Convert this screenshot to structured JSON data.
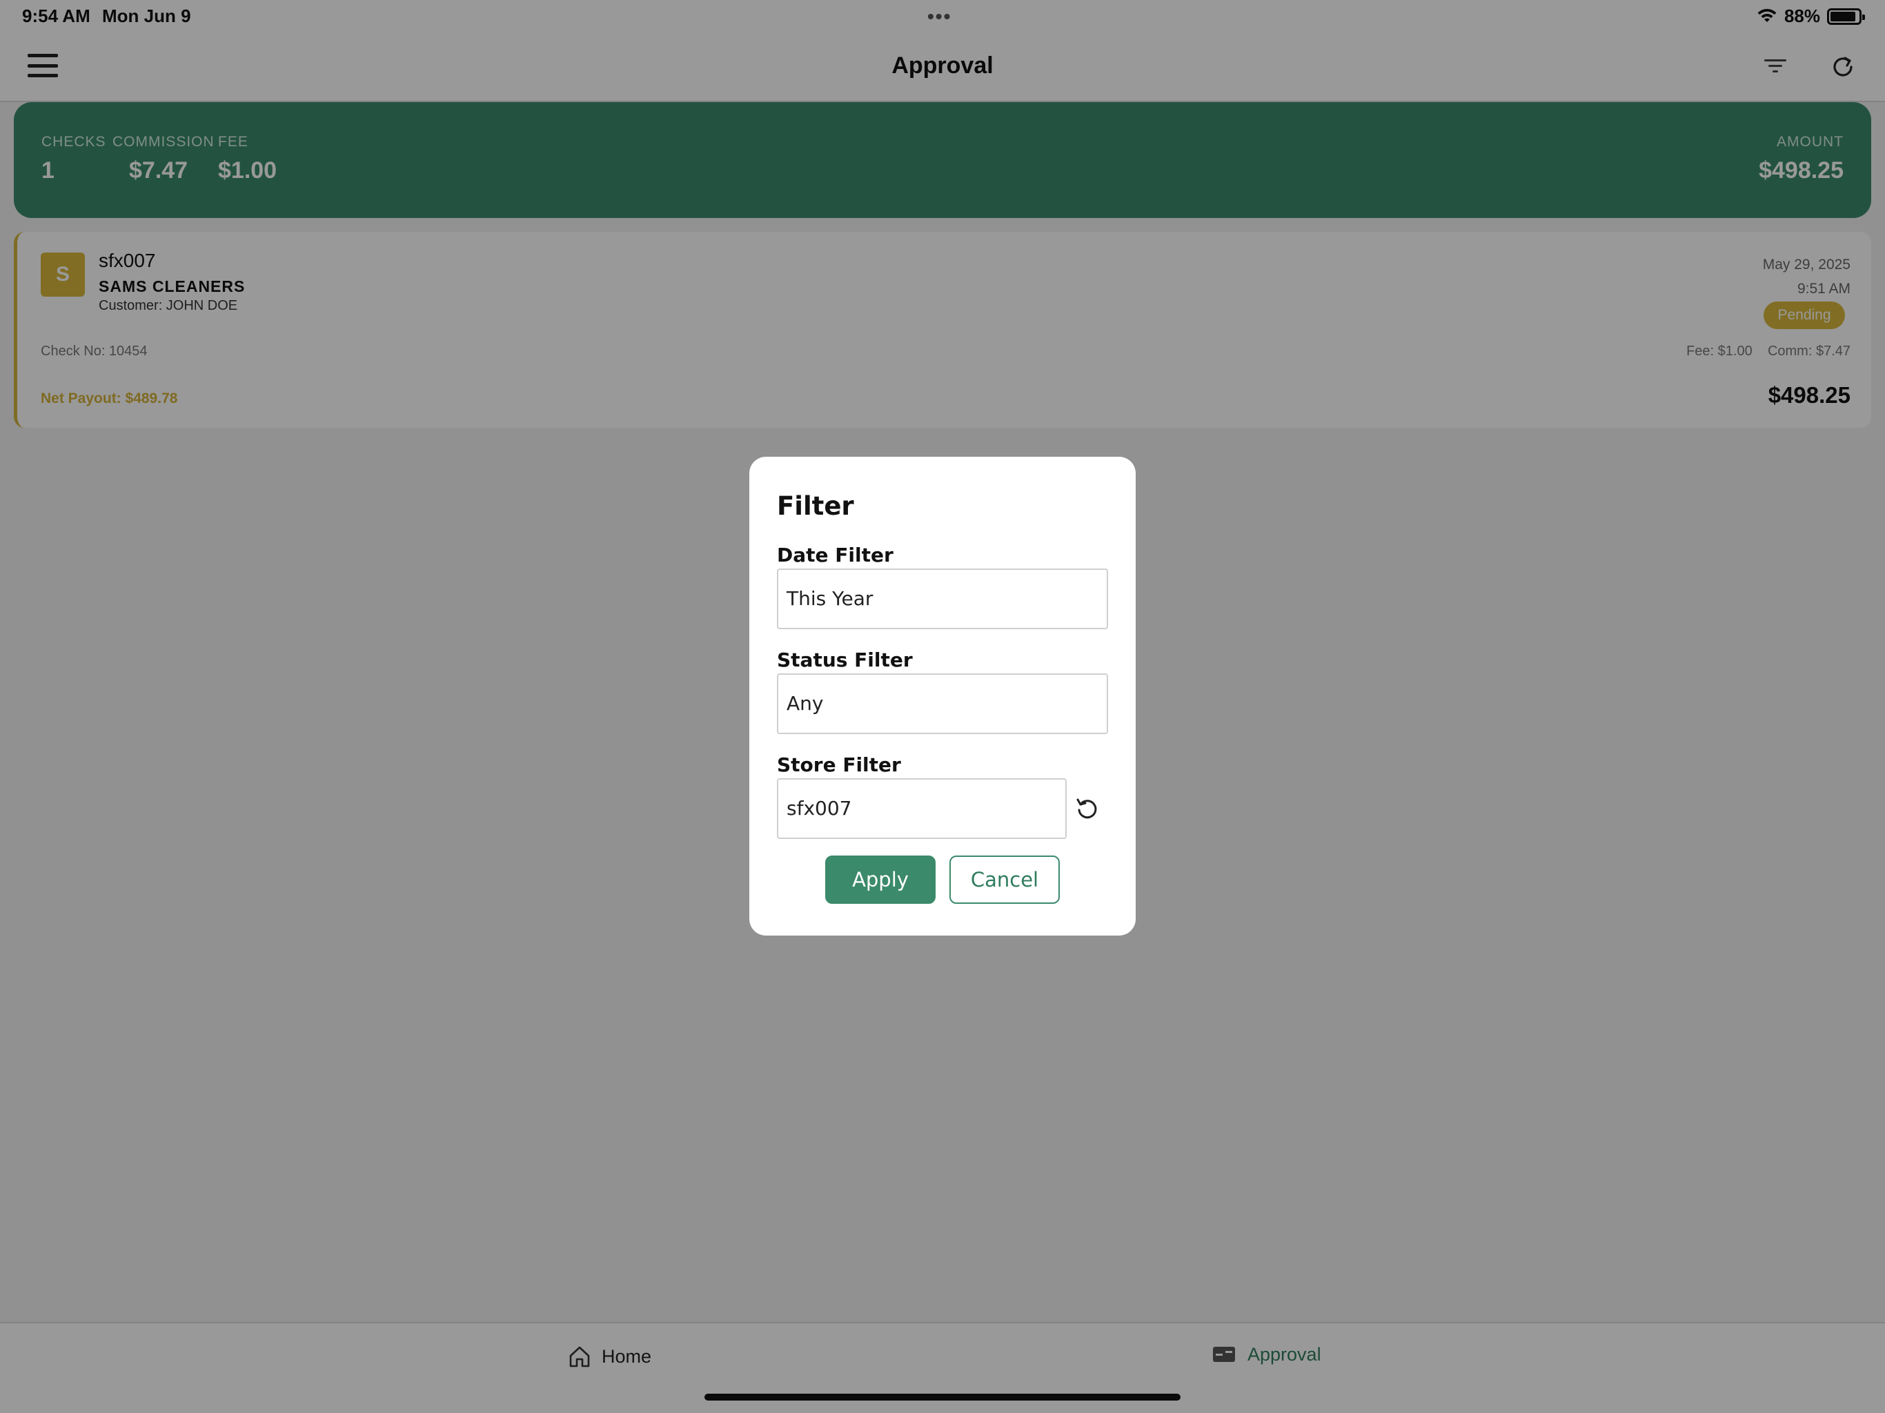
{
  "status_bar": {
    "time": "9:54 AM",
    "date": "Mon Jun 9",
    "dots": "•••",
    "battery": "88%",
    "icons": [
      "wifi-icon",
      "battery-icon"
    ]
  },
  "header": {
    "title": "Approval",
    "icons": [
      "menu-icon",
      "filter-icon",
      "refresh-icon"
    ]
  },
  "summary": {
    "checks_label": "CHECKS",
    "checks_value": "1",
    "commission_label": "COMMISSION",
    "commission_value": "$7.47",
    "fee_label": "FEE",
    "fee_value": "$1.00",
    "amount_label": "AMOUNT",
    "amount_value": "$498.25"
  },
  "transaction": {
    "avatar_letter": "S",
    "store_id": "sfx007",
    "store_name": "SAMS CLEANERS",
    "customer": "Customer: JOHN DOE",
    "date": "May 29, 2025",
    "time": "9:51 AM",
    "status": "Pending",
    "check_no": "Check No: 10454",
    "fee_comm": "Fee: $1.00    Comm: $7.47",
    "net_payout": "Net Payout: $489.78",
    "amount": "$498.25"
  },
  "tabbar": {
    "home_label": "Home",
    "approval_label": "Approval",
    "icons": [
      "home-icon",
      "check-card-icon"
    ]
  },
  "filter_modal": {
    "title": "Filter",
    "date_filter_label": "Date Filter",
    "date_filter_value": "This Year",
    "status_filter_label": "Status Filter",
    "status_filter_value": "Any",
    "store_filter_label": "Store Filter",
    "store_filter_value": "sfx007",
    "apply_label": "Apply",
    "cancel_label": "Cancel",
    "icons": [
      "reset-icon"
    ]
  },
  "colors": {
    "brand_green": "#3b8a6b",
    "pending_gold": "#d8b73c",
    "net_payout_gold": "#d4b13a"
  }
}
